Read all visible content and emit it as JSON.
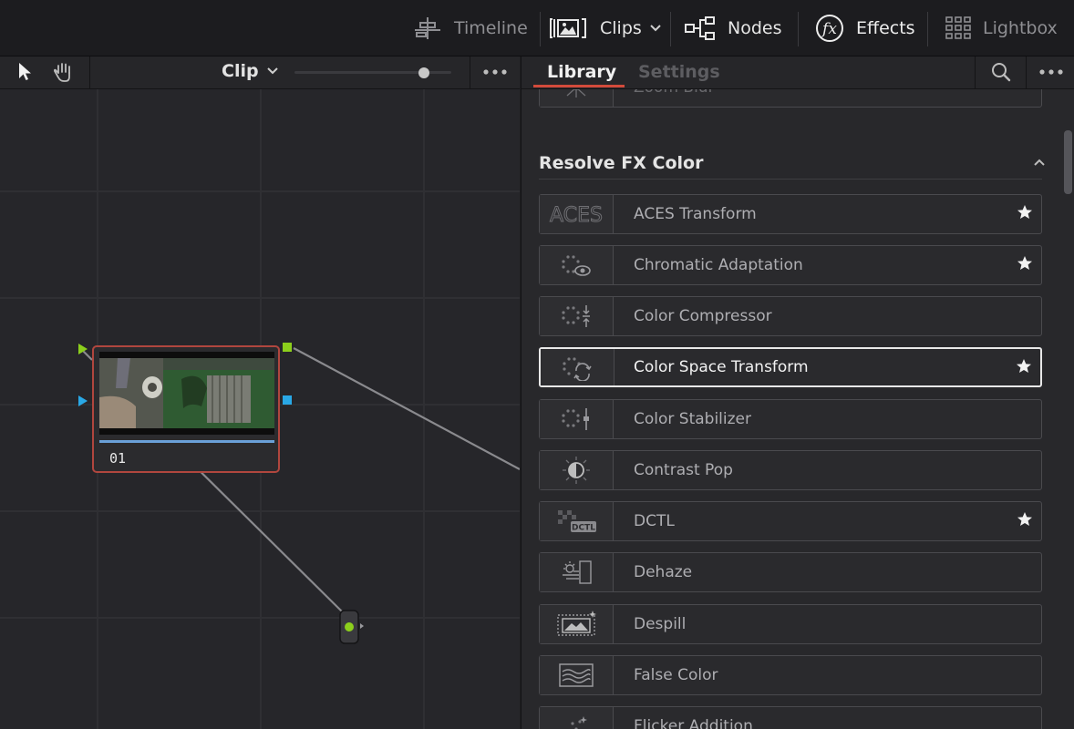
{
  "topbar": {
    "timeline_label": "Timeline",
    "clips_label": "Clips",
    "nodes_label": "Nodes",
    "effects_label": "Effects",
    "lightbox_label": "Lightbox"
  },
  "node_editor": {
    "mode_label": "Clip",
    "zoom_level": 0.85,
    "node": {
      "label": "01"
    }
  },
  "effects_panel": {
    "tabs": [
      {
        "label": "Library",
        "active": true
      },
      {
        "label": "Settings",
        "active": false
      }
    ],
    "partial_top_item": "Zoom Blur",
    "section": {
      "title": "Resolve FX Color",
      "expanded": true
    },
    "items": [
      {
        "name": "ACES Transform",
        "icon": "aces-icon",
        "favorite": true,
        "selected": false
      },
      {
        "name": "Chromatic Adaptation",
        "icon": "chromatic-adaptation-icon",
        "favorite": true,
        "selected": false
      },
      {
        "name": "Color Compressor",
        "icon": "color-compressor-icon",
        "favorite": false,
        "selected": false
      },
      {
        "name": "Color Space Transform",
        "icon": "color-space-transform-icon",
        "favorite": true,
        "selected": true
      },
      {
        "name": "Color Stabilizer",
        "icon": "color-stabilizer-icon",
        "favorite": false,
        "selected": false
      },
      {
        "name": "Contrast Pop",
        "icon": "contrast-pop-icon",
        "favorite": false,
        "selected": false
      },
      {
        "name": "DCTL",
        "icon": "dctl-icon",
        "favorite": true,
        "selected": false
      },
      {
        "name": "Dehaze",
        "icon": "dehaze-icon",
        "favorite": false,
        "selected": false
      },
      {
        "name": "Despill",
        "icon": "despill-icon",
        "favorite": false,
        "selected": false
      },
      {
        "name": "False Color",
        "icon": "false-color-icon",
        "favorite": false,
        "selected": false
      }
    ],
    "partial_bottom_item": "Flicker Addition"
  },
  "colors": {
    "accent_red": "#d24a3b",
    "node_border": "#b0463e",
    "rgb_port_green": "#8ccf1c",
    "alpha_port_blue": "#29a8e6"
  }
}
